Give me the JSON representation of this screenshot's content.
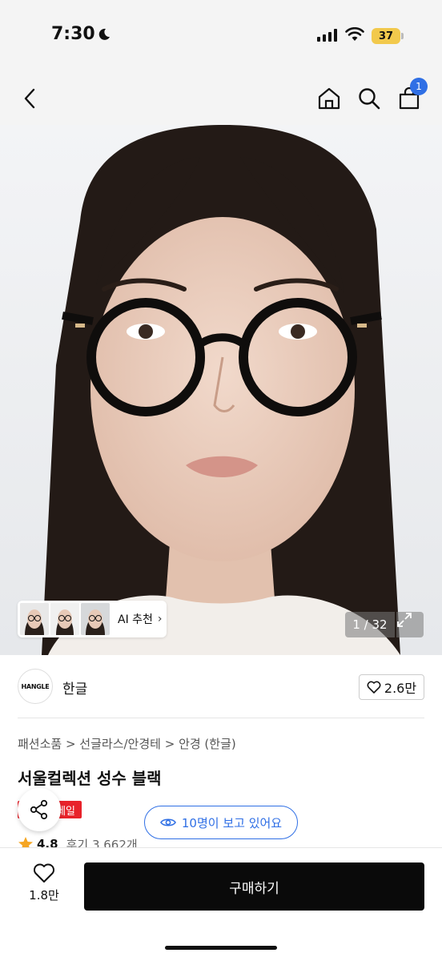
{
  "status_bar": {
    "time": "7:30",
    "battery": "37"
  },
  "nav": {
    "cart_count": "1"
  },
  "hero": {
    "ai_label": "AI 추천",
    "ai_chevron": "›",
    "counter": "1 / 32"
  },
  "brand": {
    "logo_text": "HANGLE",
    "name": "한글",
    "likes": "2.6만"
  },
  "product": {
    "breadcrumb": "패션소품 > 선글라스/안경테 > 안경 (한글)",
    "title": "서울컬렉션 성수 블랙",
    "sale_badge": "세일",
    "viewers": "10명이 보고 있어요",
    "rating": "4.8",
    "reviews": "후기 3,662개"
  },
  "bottom": {
    "wish_count": "1.8만",
    "buy_label": "구매하기"
  },
  "colors": {
    "accent": "#2f6fe5",
    "sale": "#e8222a",
    "buy": "#0a0a0a",
    "star": "#f5a623"
  },
  "icons": [
    "moon-icon",
    "signal-icon",
    "wifi-icon",
    "back-icon",
    "home-icon",
    "search-icon",
    "cart-icon",
    "expand-icon",
    "heart-icon",
    "share-icon",
    "eye-icon",
    "star-icon"
  ]
}
